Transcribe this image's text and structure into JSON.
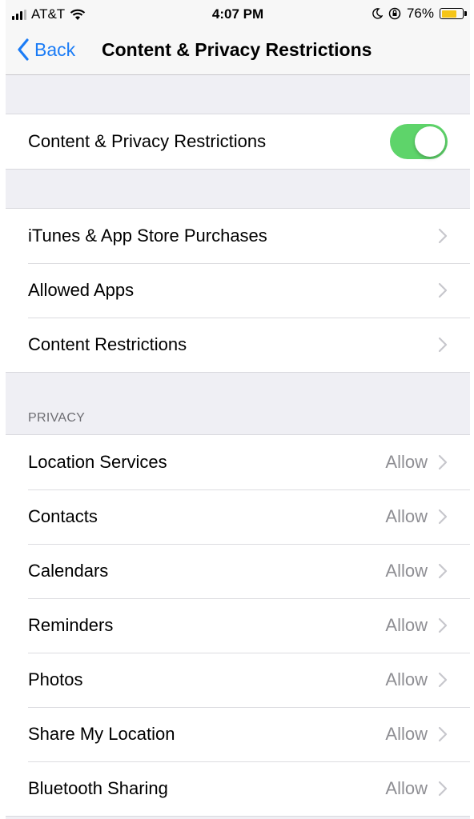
{
  "status_bar": {
    "carrier": "AT&T",
    "time": "4:07 PM",
    "battery_percent": "76%",
    "battery_level": 0.76,
    "icons": [
      "signal-icon",
      "wifi-icon",
      "moon-icon",
      "orientation-lock-icon",
      "battery-icon"
    ]
  },
  "nav": {
    "back_label": "Back",
    "title": "Content & Privacy Restrictions"
  },
  "master_toggle": {
    "label": "Content & Privacy Restrictions",
    "on": true
  },
  "restrictions": {
    "items": [
      {
        "label": "iTunes & App Store Purchases"
      },
      {
        "label": "Allowed Apps"
      },
      {
        "label": "Content Restrictions"
      }
    ]
  },
  "privacy": {
    "header": "PRIVACY",
    "items": [
      {
        "label": "Location Services",
        "value": "Allow"
      },
      {
        "label": "Contacts",
        "value": "Allow"
      },
      {
        "label": "Calendars",
        "value": "Allow"
      },
      {
        "label": "Reminders",
        "value": "Allow"
      },
      {
        "label": "Photos",
        "value": "Allow"
      },
      {
        "label": "Share My Location",
        "value": "Allow"
      },
      {
        "label": "Bluetooth Sharing",
        "value": "Allow"
      }
    ]
  },
  "colors": {
    "accent": "#1b7cf6",
    "toggle_on": "#5ed46a",
    "battery": "#f5c518",
    "background": "#efeff4"
  }
}
